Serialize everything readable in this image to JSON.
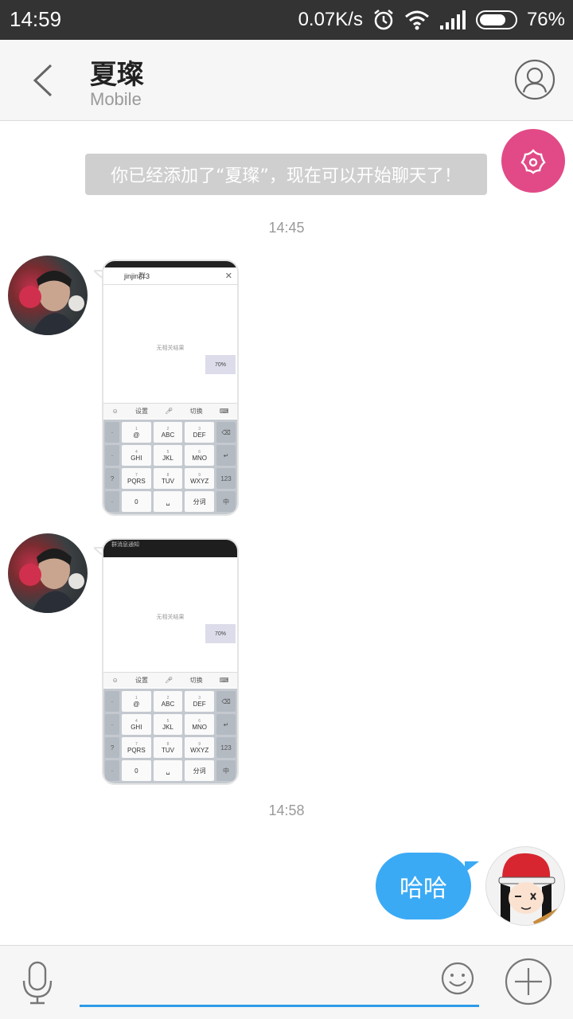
{
  "status_bar": {
    "time": "14:59",
    "net_speed": "0.07K/s",
    "battery": "76%",
    "battery_level": 0.76
  },
  "header": {
    "title": "夏璨",
    "subtitle": "Mobile",
    "back_icon": "chevron-left-icon",
    "profile_icon": "person-outline-icon"
  },
  "messages": {
    "system_notice": "你已经添加了“夏璨”，现在可以开始聊天了！",
    "timestamp_1": "14:45",
    "timestamp_2": "14:58",
    "outgoing_text": "哈哈"
  },
  "thumbnail": {
    "search_text": "jinjin群3",
    "no_result": "无相关结果",
    "popup": "70%",
    "tools": [
      "设置",
      "切换"
    ],
    "notice_bar": "群消息通知",
    "keys": [
      {
        "n": "1",
        "l": "@"
      },
      {
        "n": "2",
        "l": "ABC"
      },
      {
        "n": "3",
        "l": "DEF"
      },
      {
        "n": "4",
        "l": "GHI"
      },
      {
        "n": "5",
        "l": "JKL"
      },
      {
        "n": "6",
        "l": "MNO"
      },
      {
        "n": "7",
        "l": "PQRS"
      },
      {
        "n": "8",
        "l": "TUV"
      },
      {
        "n": "9",
        "l": "WXYZ"
      }
    ],
    "zero": "0",
    "fenci": "分词",
    "num_switch": "123"
  },
  "input_bar": {
    "placeholder": "",
    "mic_icon": "microphone-icon",
    "emoji_icon": "smiley-icon",
    "plus_icon": "plus-circle-icon"
  },
  "colors": {
    "accent_blue": "#3aaaf5",
    "fab_pink": "#e14a86",
    "status_bar_bg": "#333333"
  }
}
